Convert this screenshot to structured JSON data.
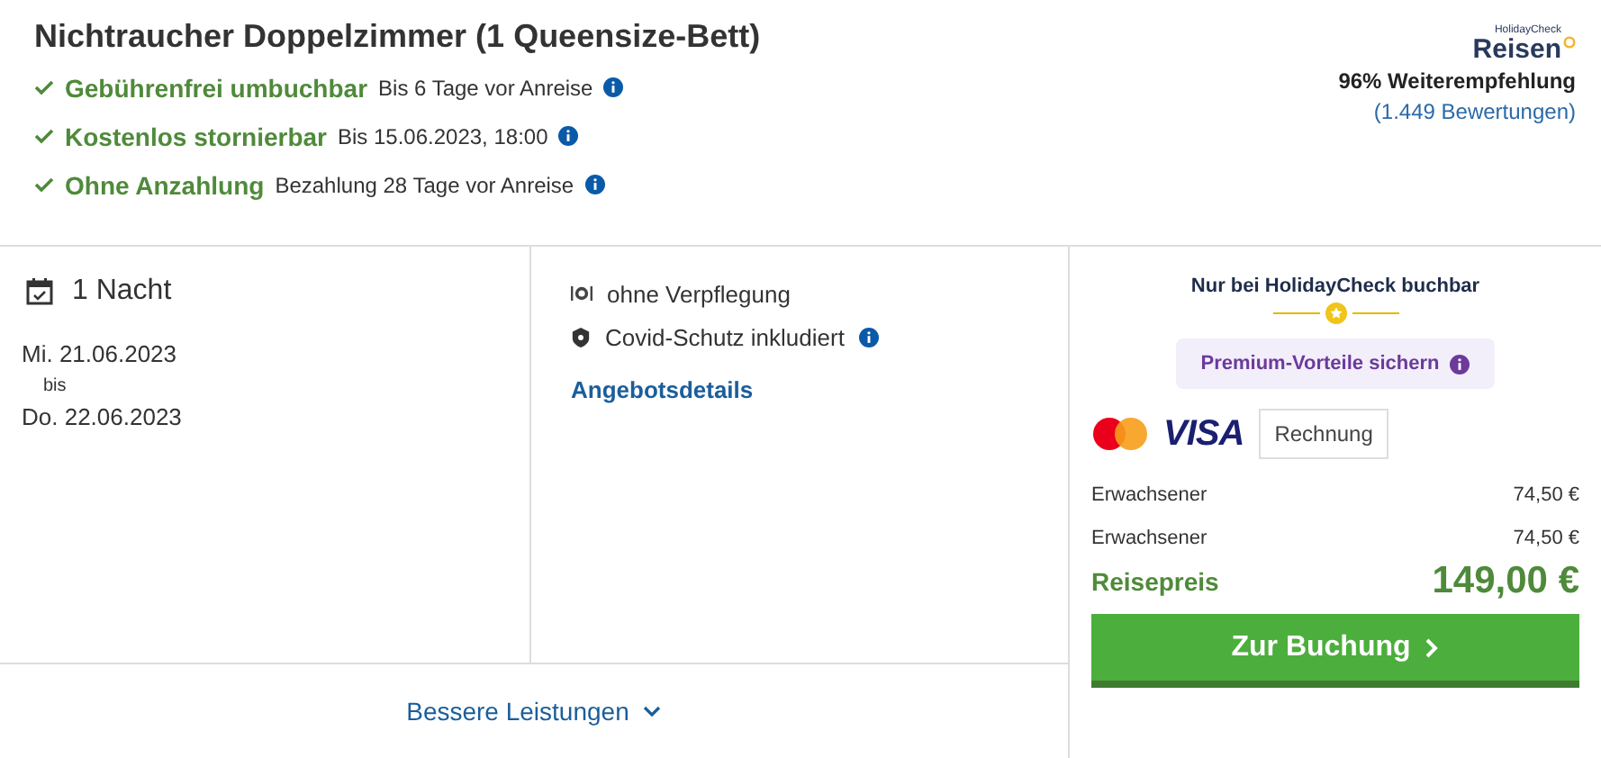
{
  "title": "Nichtraucher Doppelzimmer (1 Queensize-Bett)",
  "features": [
    {
      "label": "Gebührenfrei umbuchbar",
      "detail": "Bis 6 Tage vor Anreise"
    },
    {
      "label": "Kostenlos stornierbar",
      "detail": "Bis 15.06.2023, 18:00"
    },
    {
      "label": "Ohne Anzahlung",
      "detail": "Bezahlung 28 Tage vor Anreise"
    }
  ],
  "rating": {
    "logo_small": "HolidayCheck",
    "logo_big": "Reisen",
    "recommendation": "96% Weiterempfehlung",
    "reviews": "(1.449 Bewertungen)"
  },
  "stay": {
    "nights": "1 Nacht",
    "from": "Mi. 21.06.2023",
    "between": "bis",
    "to": "Do. 22.06.2023"
  },
  "services": [
    {
      "kind": "meal",
      "label": "ohne Verpflegung",
      "info": false
    },
    {
      "kind": "shield",
      "label": "Covid-Schutz inkludiert",
      "info": true
    }
  ],
  "details_link": "Angebotsdetails",
  "more_link": "Bessere Leistungen",
  "booking": {
    "exclusive": "Nur bei HolidayCheck buchbar",
    "premium": "Premium-Vorteile sichern",
    "visa": "VISA",
    "invoice": "Rechnung",
    "lines": [
      {
        "label": "Erwachsener",
        "price": "74,50 €"
      },
      {
        "label": "Erwachsener",
        "price": "74,50 €"
      }
    ],
    "total_label": "Reisepreis",
    "total": "149,00 €",
    "button": "Zur Buchung"
  }
}
